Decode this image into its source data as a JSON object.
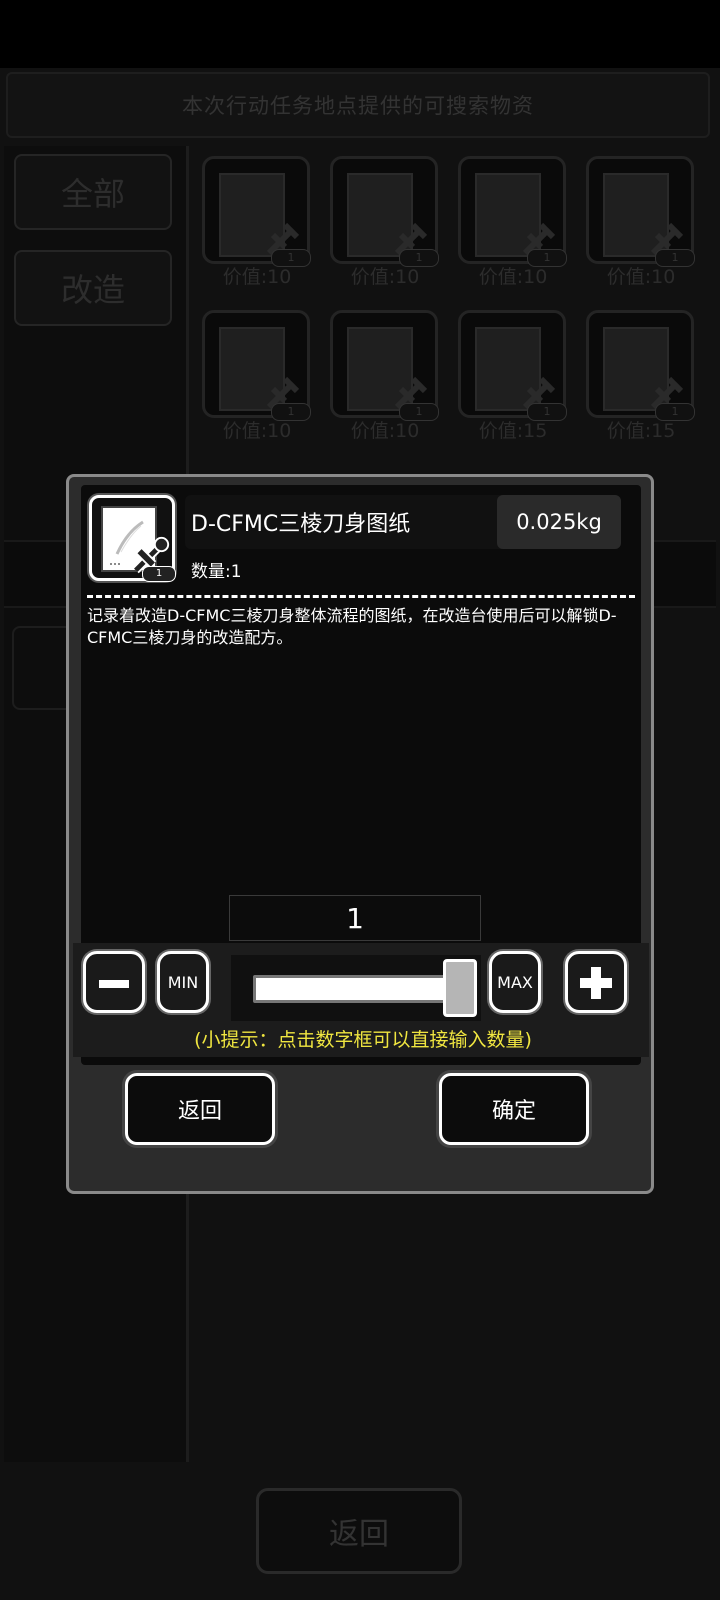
{
  "background": {
    "title": "本次行动任务地点提供的可搜索物资",
    "tabs": [
      "全部",
      "改造"
    ],
    "items": [
      {
        "value": "价值:10",
        "count": "1"
      },
      {
        "value": "价值:10",
        "count": "1"
      },
      {
        "value": "价值:10",
        "count": "1"
      },
      {
        "value": "价值:10",
        "count": "1"
      },
      {
        "value": "价值:10",
        "count": "1"
      },
      {
        "value": "价值:10",
        "count": "1"
      },
      {
        "value": "价值:15",
        "count": "1"
      },
      {
        "value": "价值:15",
        "count": "1"
      }
    ],
    "back_label": "返回"
  },
  "dialog": {
    "item": {
      "name": "D-CFMC三棱刀身图纸",
      "weight": "0.025kg",
      "quantity_text": "数量:1",
      "icon_count": "1",
      "description": "记录着改造D-CFMC三棱刀身整体流程的图纸，在改造台使用后可以解锁D-CFMC三棱刀身的改造配方。"
    },
    "selector": {
      "value": "1",
      "min_label": "MIN",
      "max_label": "MAX",
      "slider_fraction": 1.0,
      "tip": "(小提示：点击数字框可以直接输入数量)"
    },
    "back_label": "返回",
    "confirm_label": "确定"
  },
  "colors": {
    "tip": "#f0e640",
    "dialog_border": "#8a8a8a",
    "dialog_bg": "#2c2c2c"
  }
}
